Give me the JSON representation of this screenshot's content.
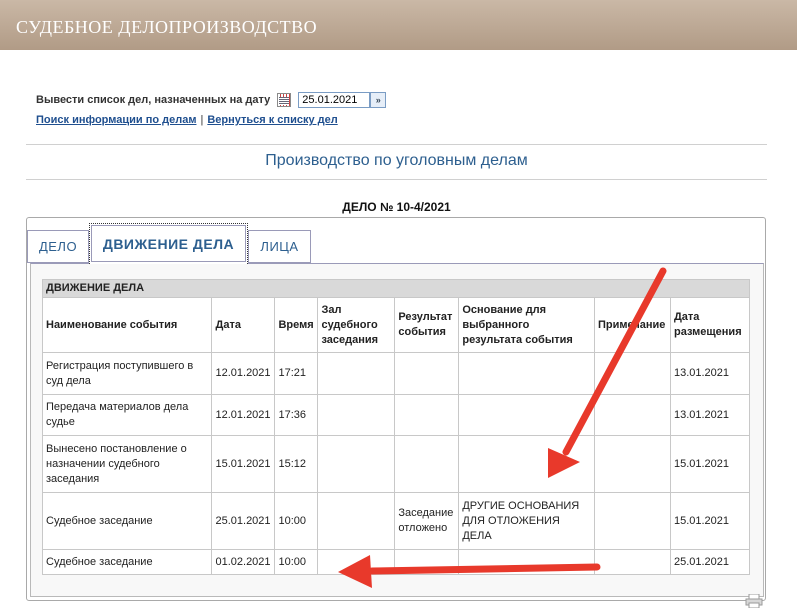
{
  "header": {
    "title": "СУДЕБНОЕ ДЕЛОПРОИЗВОДСТВО"
  },
  "datebar": {
    "label": "Вывести список дел, назначенных на дату",
    "date_value": "25.01.2021"
  },
  "links": {
    "search": "Поиск информации по делам",
    "separator": "|",
    "back": "Вернуться к списку дел"
  },
  "section_title": "Производство по уголовным делам",
  "case_number": "ДЕЛО № 10-4/2021",
  "tabs": [
    {
      "label": "ДЕЛО",
      "active": false
    },
    {
      "label": "ДВИЖЕНИЕ ДЕЛА",
      "active": true
    },
    {
      "label": "ЛИЦА",
      "active": false
    }
  ],
  "table": {
    "caption": "ДВИЖЕНИЕ ДЕЛА",
    "headers": {
      "event": "Наименование события",
      "date": "Дата",
      "time": "Время",
      "room": "Зал судебного заседания",
      "result": "Результат события",
      "basis": "Основание для выбранного результата события",
      "note": "Примечание",
      "posted": "Дата размещения"
    },
    "rows": [
      {
        "event": "Регистрация поступившего в суд дела",
        "date": "12.01.2021",
        "time": "17:21",
        "room": "",
        "result": "",
        "basis": "",
        "note": "",
        "posted": "13.01.2021"
      },
      {
        "event": "Передача материалов дела судье",
        "date": "12.01.2021",
        "time": "17:36",
        "room": "",
        "result": "",
        "basis": "",
        "note": "",
        "posted": "13.01.2021"
      },
      {
        "event": "Вынесено постановление о назначении судебного заседания",
        "date": "15.01.2021",
        "time": "15:12",
        "room": "",
        "result": "",
        "basis": "",
        "note": "",
        "posted": "15.01.2021"
      },
      {
        "event": "Судебное заседание",
        "date": "25.01.2021",
        "time": "10:00",
        "room": "",
        "result": "Заседание отложено",
        "basis": "ДРУГИЕ ОСНОВАНИЯ ДЛЯ ОТЛОЖЕНИЯ ДЕЛА",
        "note": "",
        "posted": "15.01.2021"
      },
      {
        "event": "Судебное заседание",
        "date": "01.02.2021",
        "time": "10:00",
        "room": "",
        "result": "",
        "basis": "",
        "note": "",
        "posted": "25.01.2021"
      }
    ]
  },
  "annotations": {
    "arrow_color": "#e8392b"
  },
  "icons": {
    "calendar": "calendar-icon",
    "go": "go-arrow-icon",
    "print": "printer-icon"
  }
}
